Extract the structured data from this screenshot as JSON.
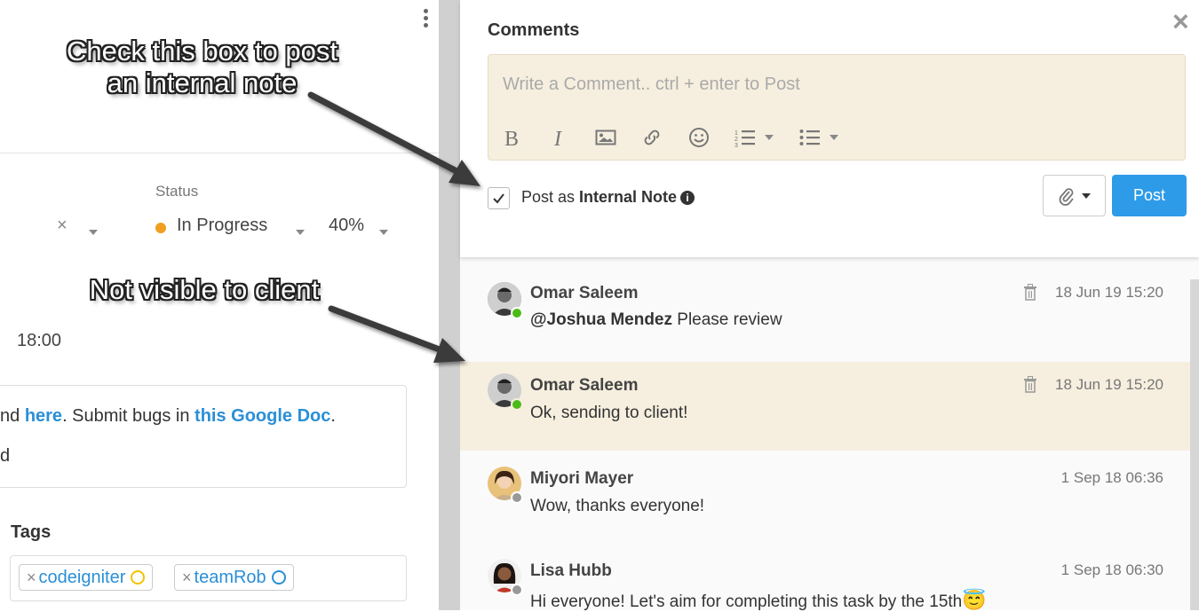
{
  "left": {
    "status_label": "Status",
    "status_value": "In Progress",
    "progress": "40%",
    "clear_symbol": "×",
    "time_value": "18:00",
    "description": {
      "prefix": "nd ",
      "link1": "here",
      "mid": ". Submit bugs in ",
      "link2": "this Google Doc",
      "suffix": ".",
      "line2": "d"
    },
    "tags_label": "Tags",
    "tags": [
      {
        "label": "codeigniter",
        "color": "#f2c200"
      },
      {
        "label": "teamRob",
        "color": "#2a8fd6"
      }
    ]
  },
  "annotations": {
    "top_line1": "Check this box to post",
    "top_line2": "an internal note",
    "bottom": "Not visible to client"
  },
  "comments_panel": {
    "title": "Comments",
    "close_icon": "×",
    "editor_placeholder": "Write a Comment.. ctrl + enter to Post",
    "toolbar_icons": [
      "bold-icon",
      "italic-icon",
      "image-icon",
      "link-icon",
      "emoji-icon",
      "ordered-list-icon",
      "unordered-list-icon"
    ],
    "internal_note_checked": true,
    "post_as_prefix": "Post as ",
    "post_as_bold": "Internal Note",
    "info_symbol": "i",
    "post_button": "Post",
    "accent_color": "#2d9be8",
    "internal_bg": "#f6efdf"
  },
  "comments": [
    {
      "author": "Omar Saleem",
      "mention": "@Joshua Mendez",
      "text": " Please review",
      "time": "18 Jun 19 15:20",
      "deletable": true,
      "internal": false,
      "online": true
    },
    {
      "author": "Omar Saleem",
      "mention": "",
      "text": "Ok, sending to client!",
      "time": "18 Jun 19 15:20",
      "deletable": true,
      "internal": true,
      "online": true
    },
    {
      "author": "Miyori Mayer",
      "mention": "",
      "text": "Wow, thanks everyone!",
      "time": "1 Sep 18 06:36",
      "deletable": false,
      "internal": false,
      "online": false
    },
    {
      "author": "Lisa Hubb",
      "mention": "",
      "text": "Hi everyone! Let's aim for completing this task by the 15th",
      "time": "1 Sep 18 06:30",
      "deletable": false,
      "internal": false,
      "online": false,
      "emoji": "😇"
    }
  ]
}
